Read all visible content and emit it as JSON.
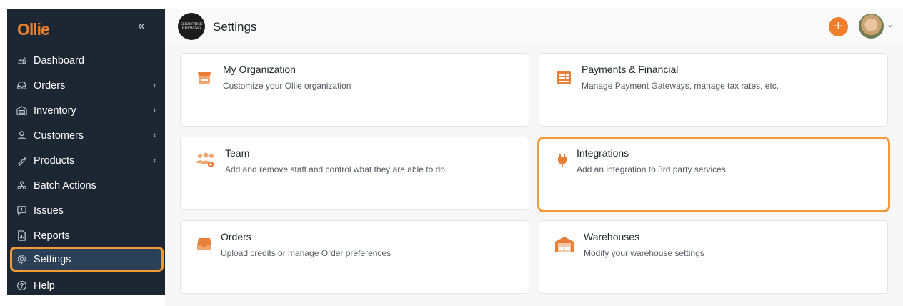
{
  "sidebar": {
    "logo": "Ollie",
    "collapse": "«",
    "items": [
      {
        "label": "Dashboard",
        "chevron": ""
      },
      {
        "label": "Orders",
        "chevron": "‹"
      },
      {
        "label": "Inventory",
        "chevron": "‹"
      },
      {
        "label": "Customers",
        "chevron": "‹"
      },
      {
        "label": "Products",
        "chevron": "‹"
      },
      {
        "label": "Batch Actions",
        "chevron": ""
      },
      {
        "label": "Issues",
        "chevron": ""
      },
      {
        "label": "Reports",
        "chevron": ""
      },
      {
        "label": "Settings",
        "chevron": ""
      },
      {
        "label": "Help",
        "chevron": ""
      }
    ]
  },
  "header": {
    "brand_line1": "SHOWTIME",
    "brand_line2": "BREWING",
    "title": "Settings",
    "add": "+",
    "avatar_chevron": "⌄"
  },
  "cards": [
    {
      "title": "My Organization",
      "desc": "Customize your Ollie organization"
    },
    {
      "title": "Payments & Financial",
      "desc": "Manage Payment Gateways, manage tax rates, etc."
    },
    {
      "title": "Team",
      "desc": "Add and remove staff and control what they are able to do"
    },
    {
      "title": "Integrations",
      "desc": "Add an integration to 3rd party services"
    },
    {
      "title": "Orders",
      "desc": "Upload credits or manage Order preferences"
    },
    {
      "title": "Warehouses",
      "desc": "Modify your warehouse settings"
    }
  ],
  "colors": {
    "sidebar_bg": "#1c2733",
    "accent": "#f07f2c",
    "highlight_border": "#f39a37",
    "active_bg": "#2a4057"
  },
  "icons": [
    "dashboard-icon",
    "orders-icon",
    "inventory-icon",
    "customers-icon",
    "products-icon",
    "batch-actions-icon",
    "issues-icon",
    "reports-icon",
    "settings-icon",
    "help-icon",
    "store-icon",
    "ledger-icon",
    "team-icon",
    "plug-icon",
    "tray-icon",
    "warehouse-icon"
  ]
}
